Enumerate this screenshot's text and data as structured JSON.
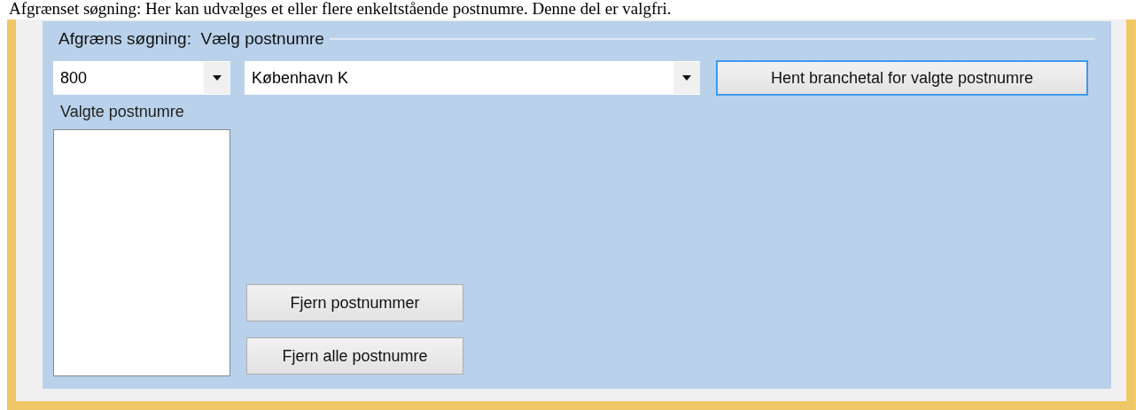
{
  "instruction": "Afgrænset søgning: Her kan udvælges et eller flere enkeltstående postnumre. Denne del er valgfri.",
  "group": {
    "title": "Afgræns søgning:  Vælg postnumre"
  },
  "postcode_combo": {
    "value": "800"
  },
  "city_combo": {
    "value": "København K"
  },
  "fetch_button": {
    "label": "Hent branchetal for valgte postnumre",
    "focused": true
  },
  "selected_list": {
    "label": "Valgte postnumre"
  },
  "buttons": [
    "Fjern postnummer",
    "Fjern alle postnumre"
  ]
}
